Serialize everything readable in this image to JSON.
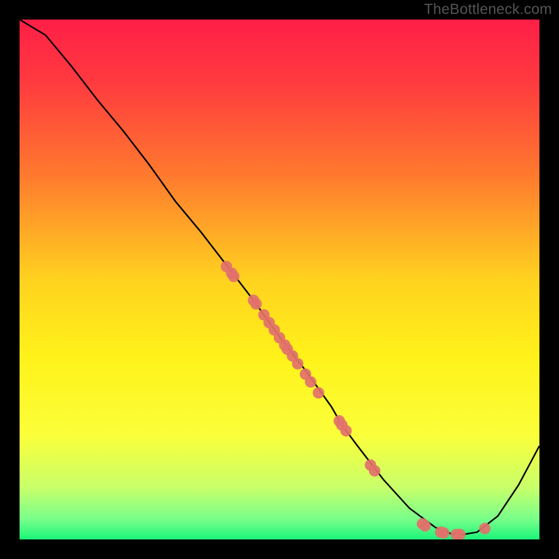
{
  "watermark": "TheBottleneck.com",
  "chart_data": {
    "type": "line",
    "title": "",
    "xlabel": "",
    "ylabel": "",
    "xlim": [
      0,
      100
    ],
    "ylim": [
      0,
      100
    ],
    "background_gradient": {
      "stops": [
        {
          "offset": 0.0,
          "color": "#ff1f47"
        },
        {
          "offset": 0.12,
          "color": "#ff3a3f"
        },
        {
          "offset": 0.3,
          "color": "#ff7a2e"
        },
        {
          "offset": 0.5,
          "color": "#ffd21f"
        },
        {
          "offset": 0.65,
          "color": "#fff21a"
        },
        {
          "offset": 0.8,
          "color": "#fbff3a"
        },
        {
          "offset": 0.9,
          "color": "#c8ff6a"
        },
        {
          "offset": 0.96,
          "color": "#7aff8a"
        },
        {
          "offset": 1.0,
          "color": "#1bf57a"
        }
      ]
    },
    "series": [
      {
        "name": "curve",
        "type": "line",
        "x": [
          0,
          5,
          10,
          15,
          20,
          25,
          30,
          35,
          40,
          45,
          50,
          55,
          60,
          62,
          65,
          70,
          75,
          80,
          83,
          85,
          88,
          92,
          96,
          100
        ],
        "y": [
          100,
          97,
          91,
          84.5,
          78.5,
          72,
          65,
          59,
          52.5,
          46,
          39,
          32.5,
          25.5,
          22,
          18,
          11.5,
          6,
          2.3,
          1.1,
          0.9,
          1.4,
          4.5,
          10.5,
          18
        ]
      },
      {
        "name": "scatter-points",
        "type": "scatter",
        "points": [
          {
            "x": 39.8,
            "y": 52.5
          },
          {
            "x": 40.8,
            "y": 51.2
          },
          {
            "x": 41.2,
            "y": 50.6
          },
          {
            "x": 45.0,
            "y": 46.0
          },
          {
            "x": 45.5,
            "y": 45.3
          },
          {
            "x": 47.0,
            "y": 43.2
          },
          {
            "x": 48.0,
            "y": 41.7
          },
          {
            "x": 49.0,
            "y": 40.3
          },
          {
            "x": 50.0,
            "y": 38.8
          },
          {
            "x": 51.0,
            "y": 37.4
          },
          {
            "x": 51.5,
            "y": 36.6
          },
          {
            "x": 52.5,
            "y": 35.3
          },
          {
            "x": 53.5,
            "y": 33.8
          },
          {
            "x": 55.0,
            "y": 31.8
          },
          {
            "x": 56.0,
            "y": 30.3
          },
          {
            "x": 57.5,
            "y": 28.2
          },
          {
            "x": 61.5,
            "y": 22.8
          },
          {
            "x": 62.0,
            "y": 22.0
          },
          {
            "x": 62.8,
            "y": 20.9
          },
          {
            "x": 67.5,
            "y": 14.3
          },
          {
            "x": 68.3,
            "y": 13.2
          },
          {
            "x": 77.5,
            "y": 3.0
          },
          {
            "x": 78.0,
            "y": 2.6
          },
          {
            "x": 81.0,
            "y": 1.4
          },
          {
            "x": 81.6,
            "y": 1.25
          },
          {
            "x": 84.0,
            "y": 0.95
          },
          {
            "x": 84.7,
            "y": 0.95
          },
          {
            "x": 89.5,
            "y": 2.1
          }
        ]
      }
    ]
  }
}
